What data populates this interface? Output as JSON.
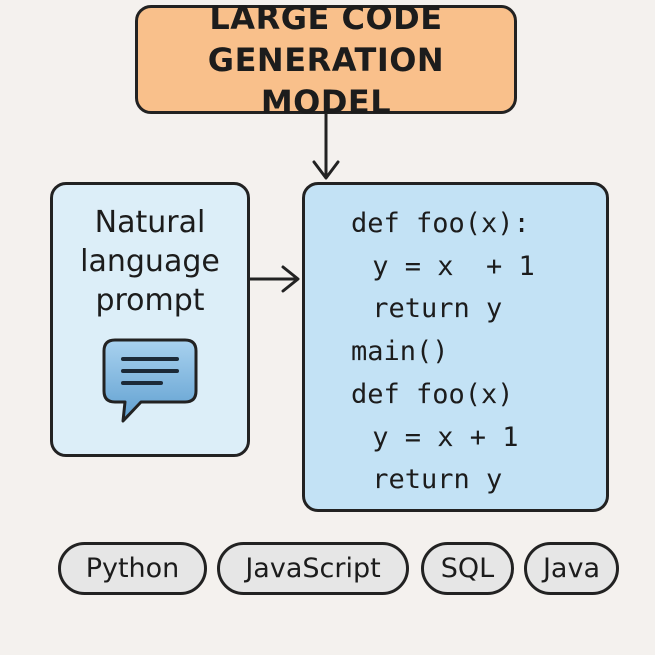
{
  "model": {
    "line1": "LARGE CODE",
    "line2": "GENERATION MODEL"
  },
  "prompt": {
    "line1": "Natural",
    "line2": "language",
    "line3": "prompt",
    "icon": "chat-bubble-icon"
  },
  "code": {
    "lines": [
      "def foo(x):",
      " y = x  + 1",
      " return y",
      "main()",
      "def foo(x)",
      " y = x + 1",
      " return y"
    ]
  },
  "languages": [
    "Python",
    "JavaScript",
    "SQL",
    "Java"
  ],
  "colors": {
    "model_fill": "#f9c08b",
    "prompt_fill": "#dceef8",
    "code_fill": "#c3e2f5",
    "tag_fill": "#e6e6e6",
    "icon_fill": "#7fb6de"
  }
}
